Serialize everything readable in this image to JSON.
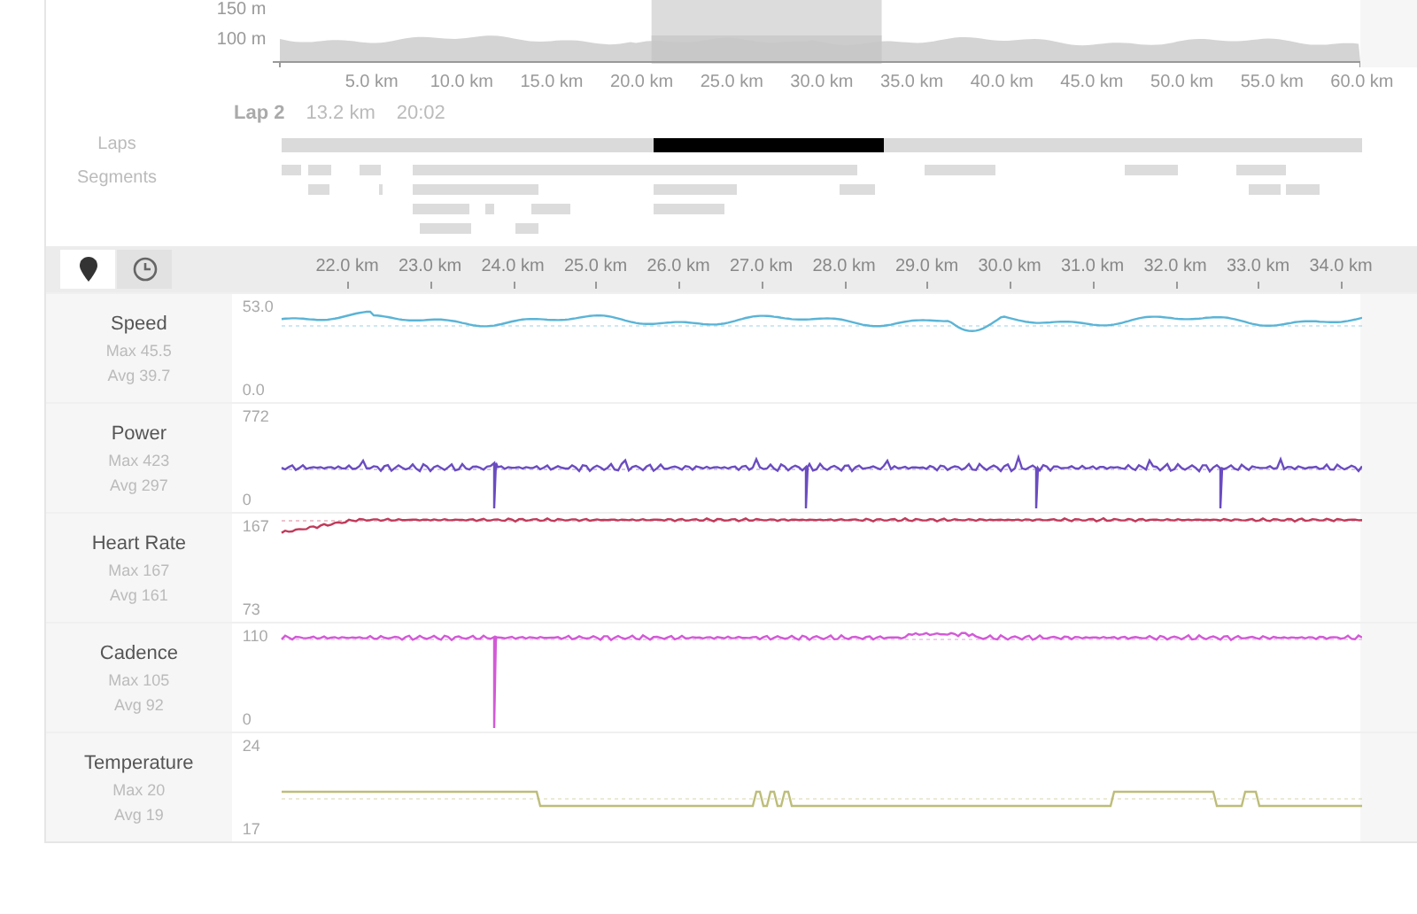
{
  "elevation_chart": {
    "y_labels": [
      "150 m",
      "100 m"
    ],
    "x_labels": [
      "5.0 km",
      "10.0 km",
      "15.0 km",
      "20.0 km",
      "25.0 km",
      "30.0 km",
      "35.0 km",
      "40.0 km",
      "45.0 km",
      "50.0 km",
      "55.0 km",
      "60.0 km"
    ]
  },
  "lap_info": {
    "name": "Lap 2",
    "distance": "13.2 km",
    "time": "20:02"
  },
  "laps": {
    "label": "Laps",
    "items": [
      {
        "selected": false
      },
      {
        "selected": true
      },
      {
        "selected": false
      }
    ]
  },
  "segments": {
    "label": "Segments"
  },
  "toolbar": {
    "buttons": [
      {
        "kind": "map-pin",
        "selected": true
      },
      {
        "kind": "clock",
        "selected": false
      }
    ],
    "x_labels": [
      "22.0 km",
      "23.0 km",
      "24.0 km",
      "25.0 km",
      "26.0 km",
      "27.0 km",
      "28.0 km",
      "29.0 km",
      "30.0 km",
      "31.0 km",
      "32.0 km",
      "33.0 km",
      "34.0 km"
    ]
  },
  "streams": [
    {
      "kind": "speed",
      "name": "Speed",
      "max": "Max 45.5",
      "avg": "Avg 39.7",
      "y_max": "53.0",
      "y_min": "0.0",
      "color": "#5ab4d6"
    },
    {
      "kind": "power",
      "name": "Power",
      "max": "Max 423",
      "avg": "Avg 297",
      "y_max": "772",
      "y_min": "0",
      "color": "#6a4cc0"
    },
    {
      "kind": "heart_rate",
      "name": "Heart Rate",
      "max": "Max 167",
      "avg": "Avg 161",
      "y_max": "167",
      "y_min": "73",
      "color": "#c03a5a"
    },
    {
      "kind": "cadence",
      "name": "Cadence",
      "max": "Max 105",
      "avg": "Avg 92",
      "y_max": "110",
      "y_min": "0",
      "color": "#d25ad6"
    },
    {
      "kind": "temperature",
      "name": "Temperature",
      "max": "Max 20",
      "avg": "Avg 19",
      "y_max": "24",
      "y_min": "17",
      "color": "#bdbd7a"
    }
  ]
}
